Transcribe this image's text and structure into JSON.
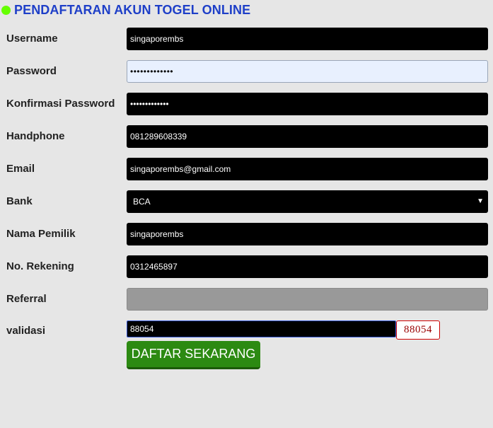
{
  "header": {
    "title": "PENDAFTARAN AKUN TOGEL ONLINE"
  },
  "form": {
    "username": {
      "label": "Username",
      "value": "singaporembs"
    },
    "password": {
      "label": "Password",
      "value": "•••••••••••••"
    },
    "confirm_password": {
      "label": "Konfirmasi Password",
      "value": "•••••••••••••"
    },
    "handphone": {
      "label": "Handphone",
      "value": "081289608339"
    },
    "email": {
      "label": "Email",
      "value": "singaporembs@gmail.com"
    },
    "bank": {
      "label": "Bank",
      "value": "BCA"
    },
    "nama_pemilik": {
      "label": "Nama Pemilik",
      "value": "singaporembs"
    },
    "no_rekening": {
      "label": "No. Rekening",
      "value": "0312465897"
    },
    "referral": {
      "label": "Referral",
      "value": ""
    },
    "validasi": {
      "label": "validasi",
      "value": "88054",
      "captcha": "88054"
    },
    "submit_label": "DAFTAR SEKARANG"
  },
  "colors": {
    "title": "#1e3fc8",
    "status_dot": "#66ff00",
    "submit_bg": "#2c8a12",
    "captcha_text": "#990000",
    "field_bg": "#000000"
  },
  "icons": {
    "status": "green-dot-icon",
    "select_arrow": "triangle-down-icon"
  }
}
